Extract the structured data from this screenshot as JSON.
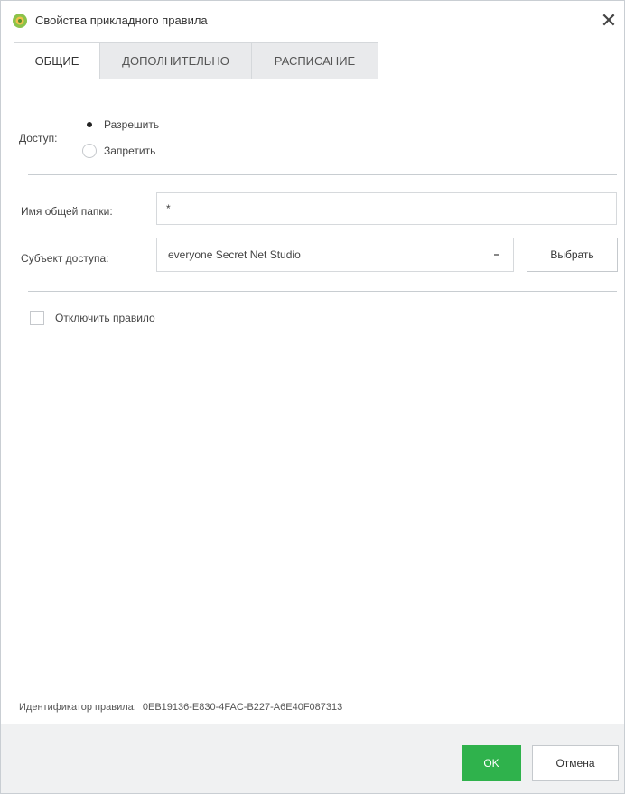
{
  "window": {
    "title": "Свойства прикладного правила",
    "close_glyph": "✕",
    "icon": "app-shield-icon",
    "accent_color": "#2fb24c"
  },
  "tabs": [
    {
      "label": "ОБЩИЕ",
      "active": true
    },
    {
      "label": "ДОПОЛНИТЕЛЬНО",
      "active": false
    },
    {
      "label": "РАСПИСАНИЕ",
      "active": false
    }
  ],
  "access": {
    "label": "Доступ:",
    "options": [
      {
        "label": "Разрешить",
        "checked": true
      },
      {
        "label": "Запретить",
        "checked": false
      }
    ]
  },
  "shared_folder": {
    "label": "Имя общей папки:",
    "value": "*"
  },
  "subject": {
    "label": "Субъект доступа:",
    "value": "everyone Secret Net Studio",
    "dropdown_icon": "chevron-down-icon",
    "choose_button": "Выбрать"
  },
  "disable_rule": {
    "label": "Отключить правило",
    "checked": false
  },
  "rule_id": {
    "label": "Идентификатор правила:",
    "value": "0EB19136-E830-4FAC-B227-A6E40F087313"
  },
  "footer": {
    "ok_label": "OK",
    "cancel_label": "Отмена"
  }
}
